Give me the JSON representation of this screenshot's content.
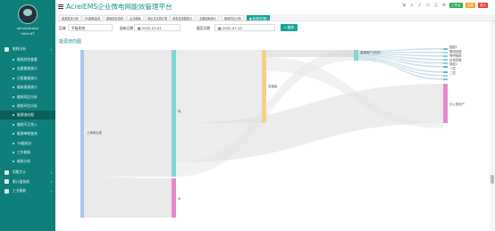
{
  "app": {
    "title": "AcrelEMS企业微电网能效管理平台"
  },
  "user": {
    "name": "administrator",
    "role": "Hefei NT"
  },
  "sidebar": {
    "items": [
      {
        "label": "能耗分析",
        "type": "parent"
      },
      {
        "label": "能耗综合查看",
        "type": "child"
      },
      {
        "label": "支路能耗统计",
        "type": "child"
      },
      {
        "label": "日报能耗统计",
        "type": "child"
      },
      {
        "label": "能耗报表统计",
        "type": "child"
      },
      {
        "label": "能耗同比分析",
        "type": "child"
      },
      {
        "label": "能耗环比分析",
        "type": "child"
      },
      {
        "label": "能源流向图",
        "type": "child",
        "active": true
      },
      {
        "label": "能耗不正常入",
        "type": "child"
      },
      {
        "label": "能源单耗查询",
        "type": "child"
      },
      {
        "label": "TB能耗分",
        "type": "child"
      },
      {
        "label": "工作能耗",
        "type": "child"
      },
      {
        "label": "能耗分析",
        "type": "child"
      },
      {
        "label": "用能大斗",
        "type": "parent"
      },
      {
        "label": "碳计量系统",
        "type": "parent"
      },
      {
        "label": "工业能耗",
        "type": "parent"
      }
    ]
  },
  "tabs": [
    {
      "label": "能源首页分析"
    },
    {
      "label": "DS能耗监测"
    },
    {
      "label": "能耗综合查看"
    },
    {
      "label": "企业能耗"
    },
    {
      "label": "场区总览统计表"
    },
    {
      "label": "用电总用能统计"
    },
    {
      "label": "支路能耗统计"
    },
    {
      "label": "能耗同比分析"
    },
    {
      "label": "● 能源流向图",
      "active": true
    }
  ],
  "toolbar": {
    "badges": [
      "工作台",
      "大屏",
      "退出"
    ]
  },
  "filters": {
    "region_label": "区域",
    "region_value": "平板机构",
    "start_label": "起始日期",
    "start_value": "2022-07-01",
    "end_label": "截至日期",
    "end_value": "2022-07-10",
    "query_label": "查询"
  },
  "section": {
    "title": "能源流向图"
  },
  "colors": {
    "primary": "#16a595",
    "sidebar": "#0e7f7a",
    "title": "#17958c"
  },
  "chart_data": {
    "type": "sankey",
    "nodes": [
      {
        "name": "上海综合楼",
        "color": "#a9c6f0"
      },
      {
        "name": "电",
        "color": "#7ad8d3"
      },
      {
        "name": "水",
        "color": "#e28ccd"
      },
      {
        "name": "支路组",
        "color": "#f5d08c"
      },
      {
        "name": "普通用户",
        "color": "#88d8c8"
      },
      {
        "name": "办公室用户",
        "color": "#e28ccd"
      }
    ],
    "links": [
      {
        "source": "上海综合楼",
        "target": "电",
        "value": 70
      },
      {
        "source": "上海综合楼",
        "target": "水",
        "value": 24
      },
      {
        "source": "电",
        "target": "支路组",
        "value": 22
      },
      {
        "source": "电",
        "target": "办公室用户",
        "value": 8
      },
      {
        "source": "电",
        "target": "普通用户",
        "value": 5
      },
      {
        "source": "支路组",
        "target": "普通用户",
        "value": 3
      }
    ],
    "node_labels": [
      "上海综合楼",
      "电",
      "水",
      "支路组",
      "普通用户(负荷)",
      "办公室用户"
    ],
    "leaf_labels": [
      "插座1",
      "照明回路",
      "照明插座",
      "空调回路",
      "插座2",
      "一层",
      "二层"
    ]
  }
}
